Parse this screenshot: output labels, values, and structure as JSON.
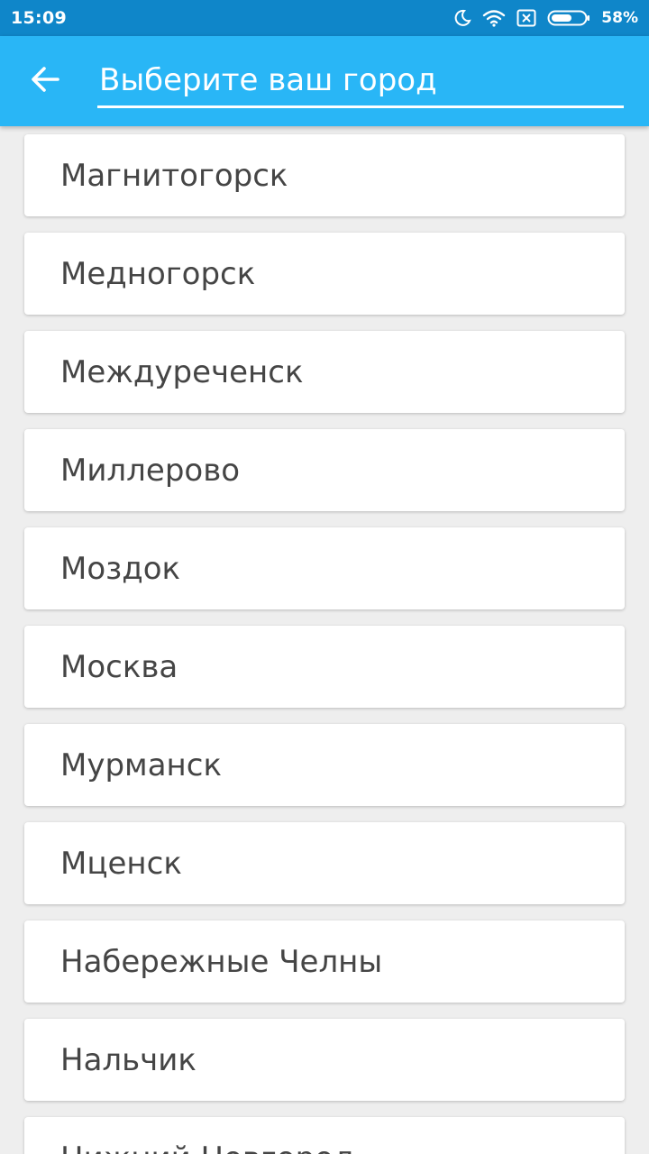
{
  "status_bar": {
    "time": "15:09",
    "battery_percent": "58%",
    "icons": [
      "moon-icon",
      "wifi-icon",
      "sim-disabled-icon",
      "battery-icon"
    ]
  },
  "header": {
    "search_placeholder": "Выберите ваш город",
    "search_value": "",
    "back_icon": "arrow-left-icon",
    "accent_color": "#29b6f6",
    "status_bar_color": "#0f86c9"
  },
  "cities": [
    "Магнитогорск",
    "Медногорск",
    "Междуреченск",
    "Миллерово",
    "Моздок",
    "Москва",
    "Мурманск",
    "Мценск",
    "Набережные Челны",
    "Нальчик",
    "Нижний Новгород"
  ]
}
